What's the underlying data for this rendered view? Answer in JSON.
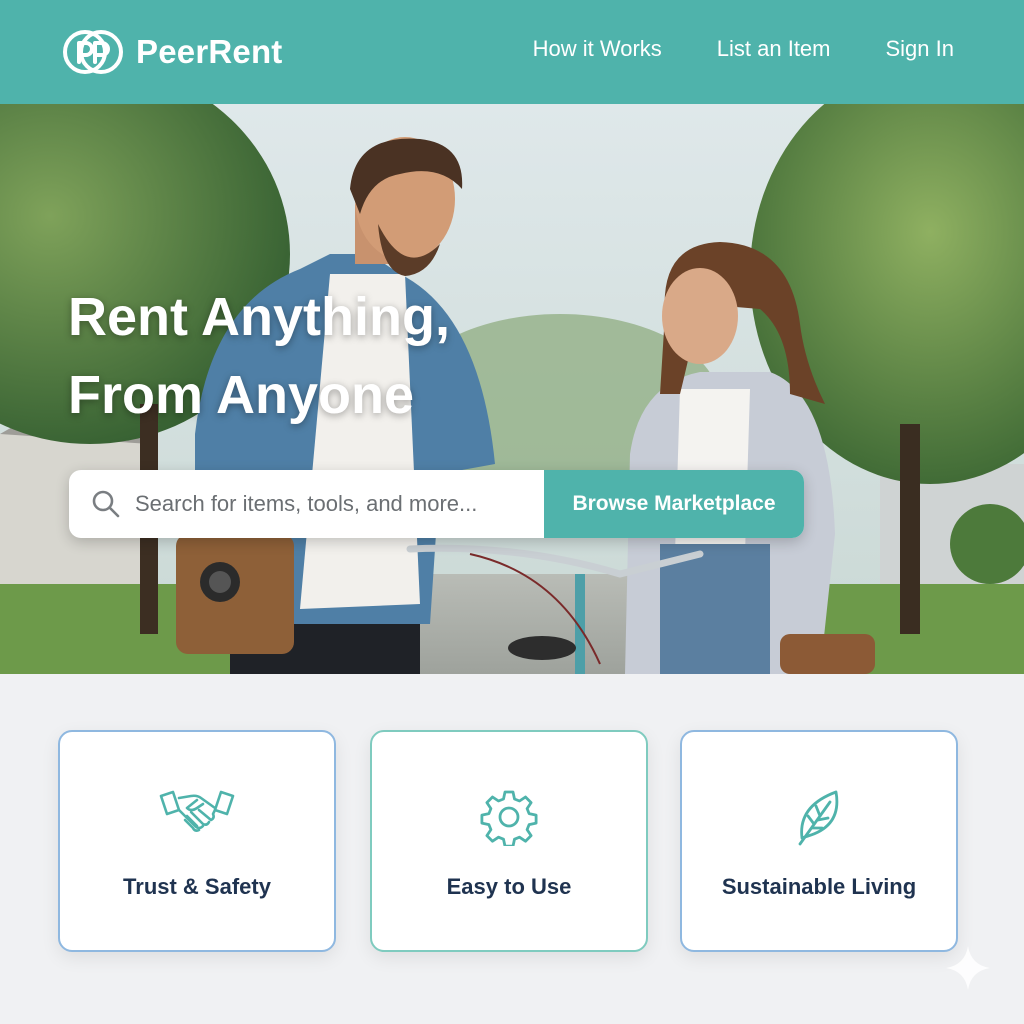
{
  "brand": {
    "name": "PeerRent",
    "logo_icon": "pp-logo-icon"
  },
  "nav": {
    "links": [
      "How it Works",
      "List an Item",
      "Sign In"
    ]
  },
  "hero": {
    "title_line1": "Rent Anything,",
    "title_line2": "From Anyone",
    "search_placeholder": "Search for items, tools, and more...",
    "browse_label": "Browse Marketplace"
  },
  "features": [
    {
      "label": "Trust & Safety",
      "icon": "handshake-icon"
    },
    {
      "label": "Easy to Use",
      "icon": "gear-icon"
    },
    {
      "label": "Sustainable Living",
      "icon": "leaf-icon"
    }
  ],
  "colors": {
    "accent": "#4fb3ab",
    "card_text": "#1f3350",
    "card_border_blue": "#8fb8e0",
    "card_border_teal": "#7fcbbf"
  }
}
